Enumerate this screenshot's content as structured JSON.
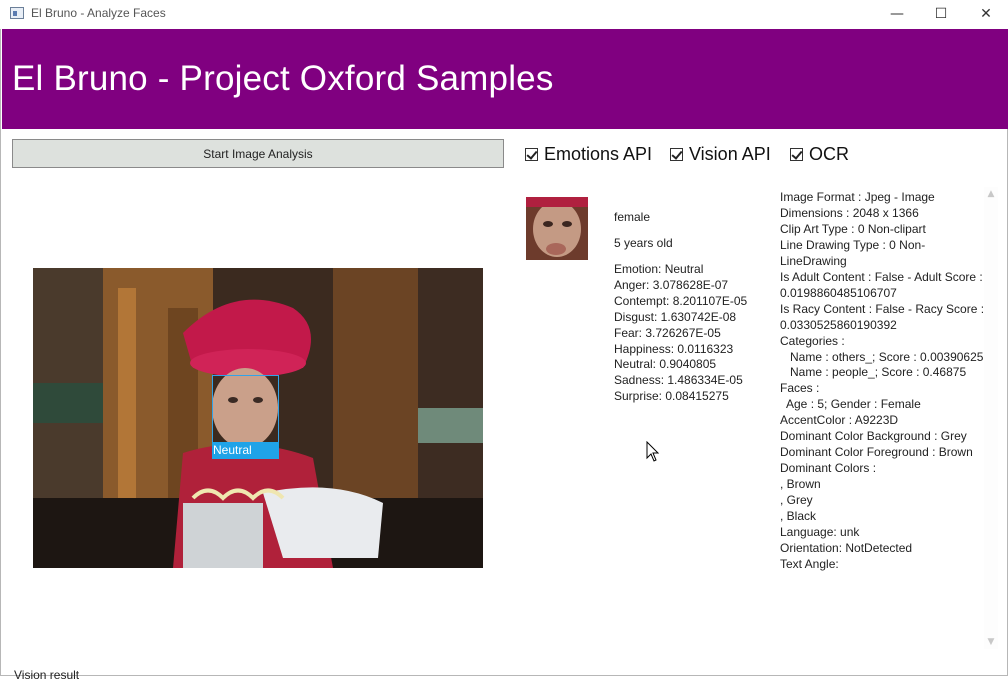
{
  "window": {
    "title": "El Bruno - Analyze Faces",
    "minimize_glyph": "—",
    "maximize_glyph": "☐",
    "close_glyph": "✕"
  },
  "header": {
    "title": "El Bruno - Project Oxford Samples",
    "color": "#800080"
  },
  "toolbar": {
    "start_button": "Start Image Analysis",
    "checkboxes": [
      {
        "label": "Emotions API",
        "checked": true
      },
      {
        "label": "Vision API",
        "checked": true
      },
      {
        "label": "OCR",
        "checked": true
      }
    ]
  },
  "photo": {
    "face_label": "Neutral",
    "label_color": "#1fa3e8"
  },
  "face_result": {
    "gender": "female",
    "age": "5 years old",
    "emotions": [
      "Emotion: Neutral",
      "Anger: 3.078628E-07",
      "Contempt: 8.201107E-05",
      "Disgust: 1.630742E-08",
      "Fear: 3.726267E-05",
      "Happiness: 0.0116323",
      "Neutral: 0.9040805",
      "Sadness: 1.486334E-05",
      "Surprise: 0.08415275"
    ]
  },
  "vision_result": [
    "Image Format : Jpeg - Image",
    "Dimensions : 2048 x 1366",
    "Clip Art Type : 0 Non-clipart",
    "Line Drawing Type : 0 Non-",
    "LineDrawing",
    "Is Adult Content : False - Adult Score :",
    "0.0198860485106707",
    "Is Racy Content : False - Racy Score :",
    "0.0330525860190392",
    "Categories :",
    "   Name : others_; Score : 0.00390625",
    "   Name : people_; Score : 0.46875",
    "Faces :",
    "  Age : 5; Gender : Female",
    "AccentColor : A9223D",
    "Dominant Color Background : Grey",
    "Dominant Color Foreground : Brown",
    "Dominant Colors :",
    ", Brown",
    ", Grey",
    ", Black",
    "Language: unk",
    "Orientation: NotDetected",
    "Text Angle:"
  ],
  "scrollbar": {
    "up_glyph": "▲",
    "down_glyph": "▼"
  },
  "bottom_text": "Vision result"
}
